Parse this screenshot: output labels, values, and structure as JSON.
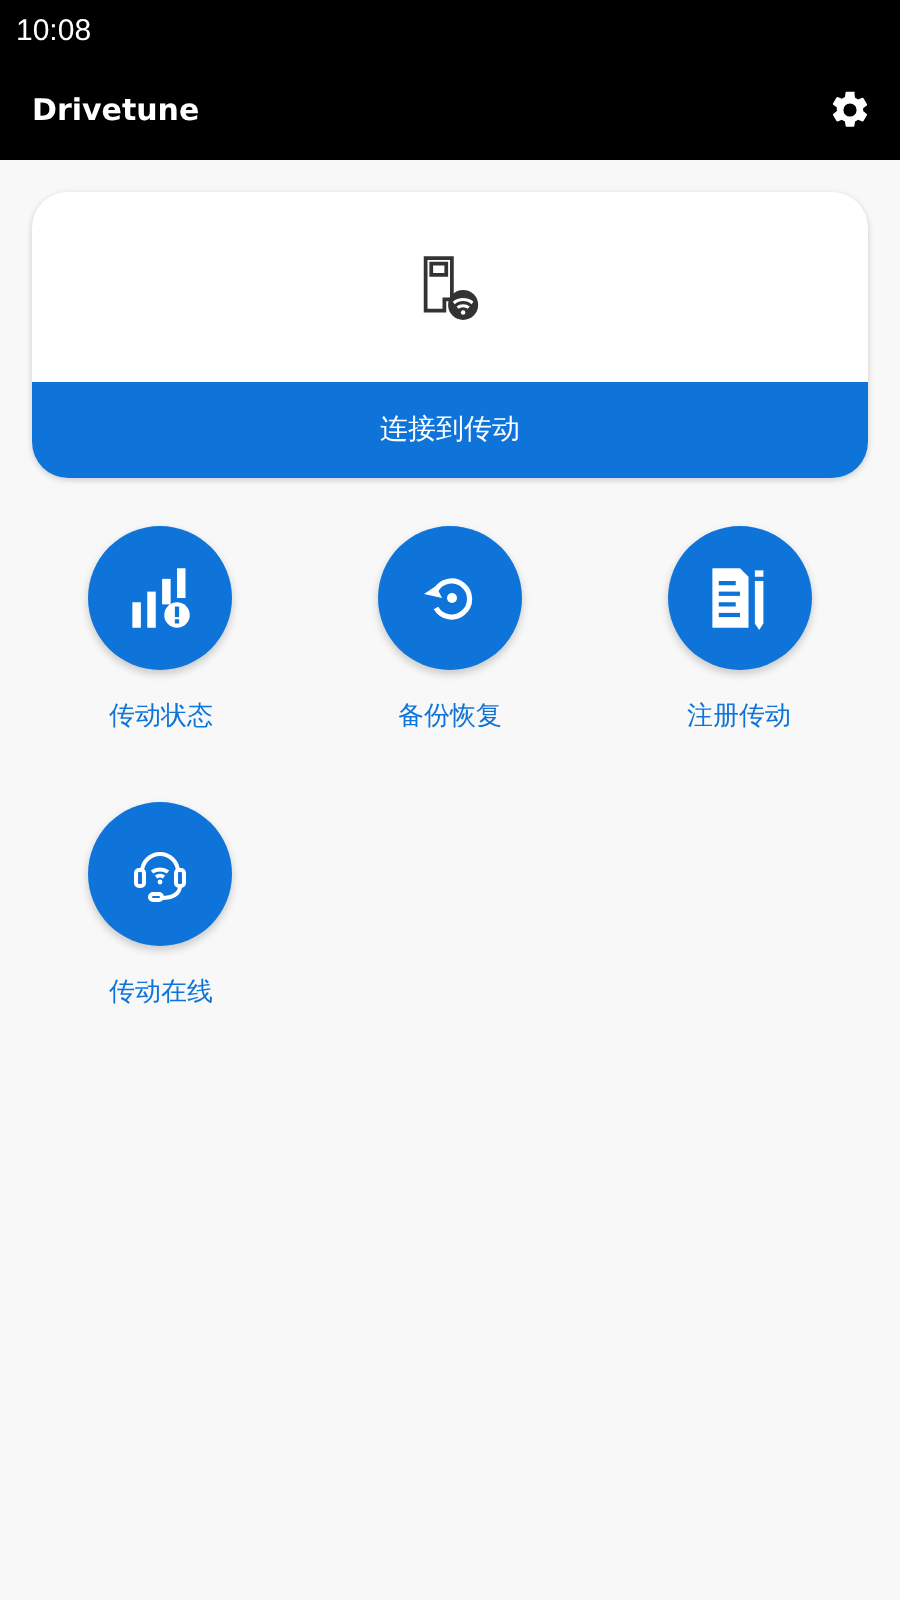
{
  "status_bar": {
    "time": "10:08"
  },
  "app_bar": {
    "title": "Drivetune"
  },
  "connect_card": {
    "button": "连接到传动"
  },
  "actions": [
    {
      "kind": "status",
      "label": "传动状态"
    },
    {
      "kind": "restore",
      "label": "备份恢复"
    },
    {
      "kind": "register",
      "label": "注册传动"
    },
    {
      "kind": "online",
      "label": "传动在线"
    }
  ]
}
